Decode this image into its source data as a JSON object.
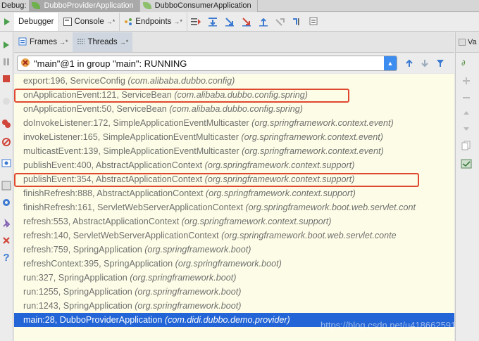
{
  "debug_bar": {
    "label": "Debug:",
    "tabs": [
      {
        "label": "DubboProviderApplication",
        "active": true
      },
      {
        "label": "DubboConsumerApplication",
        "active": false
      }
    ]
  },
  "toolbar": {
    "tabs": [
      {
        "label": "Debugger",
        "selected": true
      },
      {
        "label": "Console",
        "pin": "→*"
      },
      {
        "label": "Endpoints",
        "pin": "→*"
      }
    ]
  },
  "subheader": {
    "frames_label": "Frames",
    "frames_pin": "→*",
    "threads_label": "Threads",
    "threads_pin": "→*"
  },
  "thread_selector": {
    "value": "\"main\"@1 in group \"main\": RUNNING"
  },
  "right_panel": {
    "label": "Va"
  },
  "frames": [
    {
      "method": "export:196, ServiceConfig",
      "pkg": "(com.alibaba.dubbo.config)"
    },
    {
      "method": "onApplicationEvent:121, ServiceBean",
      "pkg": "(com.alibaba.dubbo.config.spring)",
      "highlight": true
    },
    {
      "method": "onApplicationEvent:50, ServiceBean",
      "pkg": "(com.alibaba.dubbo.config.spring)"
    },
    {
      "method": "doInvokeListener:172, SimpleApplicationEventMulticaster",
      "pkg": "(org.springframework.context.event)"
    },
    {
      "method": "invokeListener:165, SimpleApplicationEventMulticaster",
      "pkg": "(org.springframework.context.event)"
    },
    {
      "method": "multicastEvent:139, SimpleApplicationEventMulticaster",
      "pkg": "(org.springframework.context.event)"
    },
    {
      "method": "publishEvent:400, AbstractApplicationContext",
      "pkg": "(org.springframework.context.support)"
    },
    {
      "method": "publishEvent:354, AbstractApplicationContext",
      "pkg": "(org.springframework.context.support)",
      "highlight": true
    },
    {
      "method": "finishRefresh:888, AbstractApplicationContext",
      "pkg": "(org.springframework.context.support)"
    },
    {
      "method": "finishRefresh:161, ServletWebServerApplicationContext",
      "pkg": "(org.springframework.boot.web.servlet.cont"
    },
    {
      "method": "refresh:553, AbstractApplicationContext",
      "pkg": "(org.springframework.context.support)"
    },
    {
      "method": "refresh:140, ServletWebServerApplicationContext",
      "pkg": "(org.springframework.boot.web.servlet.conte"
    },
    {
      "method": "refresh:759, SpringApplication",
      "pkg": "(org.springframework.boot)"
    },
    {
      "method": "refreshContext:395, SpringApplication",
      "pkg": "(org.springframework.boot)"
    },
    {
      "method": "run:327, SpringApplication",
      "pkg": "(org.springframework.boot)"
    },
    {
      "method": "run:1255, SpringApplication",
      "pkg": "(org.springframework.boot)"
    },
    {
      "method": "run:1243, SpringApplication",
      "pkg": "(org.springframework.boot)"
    },
    {
      "method": "main:28, DubboProviderApplication",
      "pkg": "(com.didi.dubbo.demo.provider)",
      "selected": true
    }
  ],
  "watermark": "https://blog.csdn.net/u418662591"
}
